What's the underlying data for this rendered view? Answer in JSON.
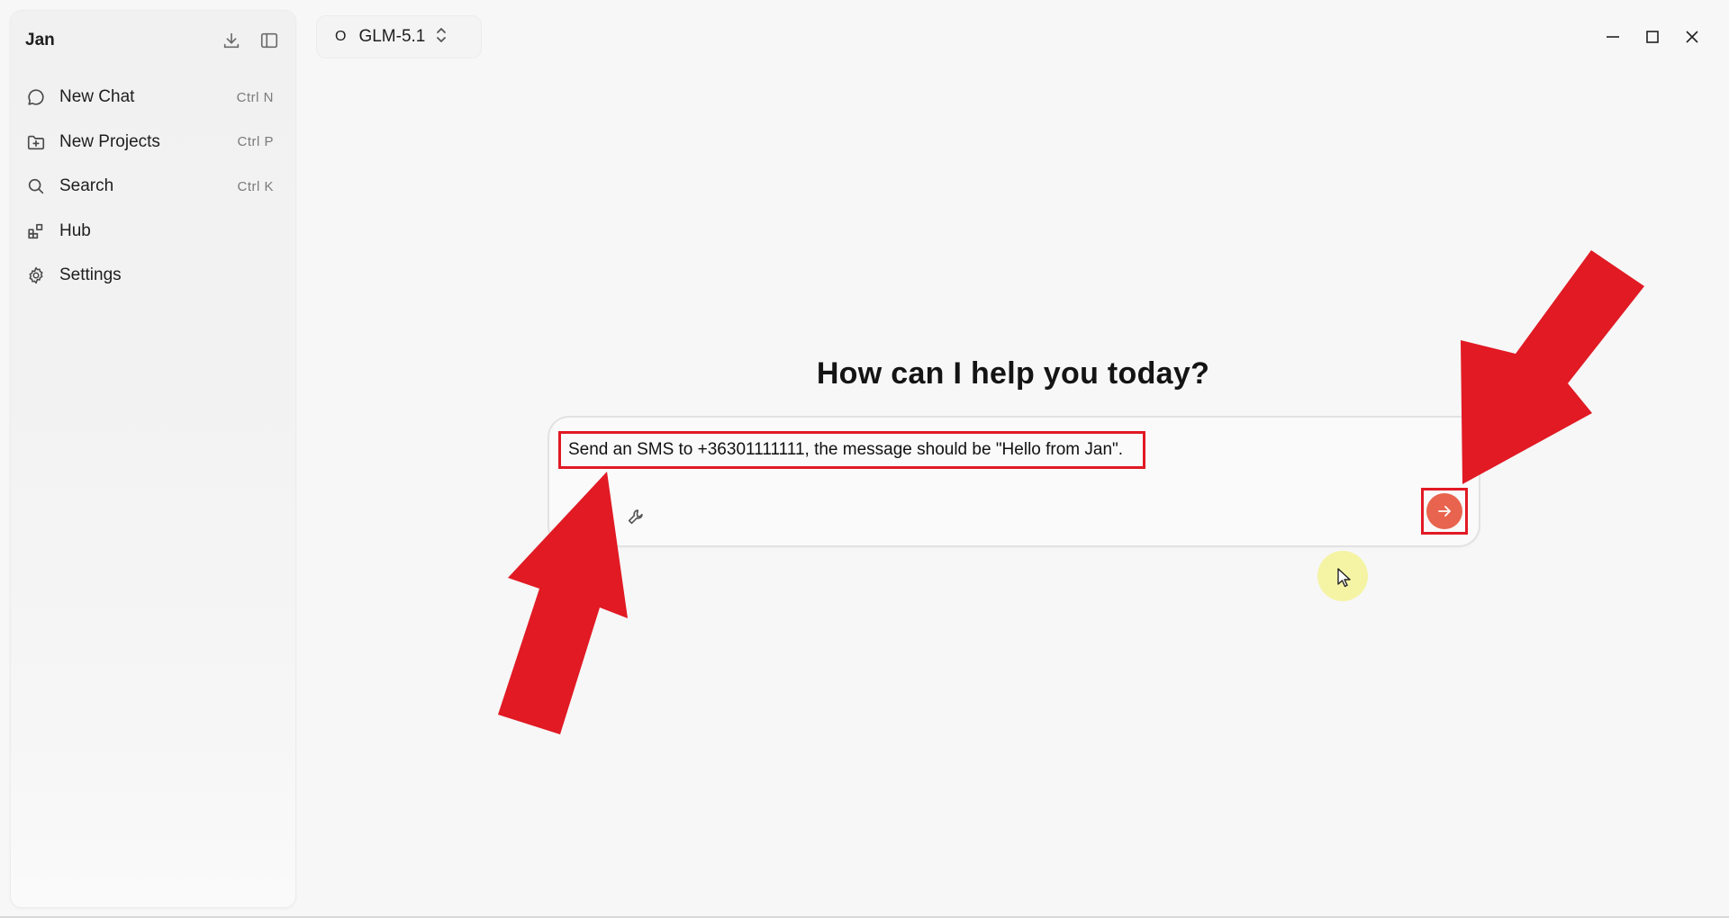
{
  "sidebar": {
    "app_name": "Jan",
    "items": [
      {
        "label": "New Chat",
        "shortcut": "Ctrl  N",
        "icon": "chat-bubble-icon"
      },
      {
        "label": "New Projects",
        "shortcut": "Ctrl  P",
        "icon": "folder-plus-icon"
      },
      {
        "label": "Search",
        "shortcut": "Ctrl  K",
        "icon": "search-icon"
      },
      {
        "label": "Hub",
        "shortcut": "",
        "icon": "blocks-icon"
      },
      {
        "label": "Settings",
        "shortcut": "",
        "icon": "gear-icon"
      }
    ]
  },
  "model_selector": {
    "badge": "O",
    "name": "GLM-5.1"
  },
  "main": {
    "greeting": "How can I help you today?",
    "composer": {
      "value": "Send an SMS to +36301111111, the message should be \"Hello from Jan\".",
      "placeholder": ""
    }
  },
  "colors": {
    "accent": "#e8644e",
    "annotation_red": "#e11a24",
    "cursor_highlight": "#f5f396"
  }
}
